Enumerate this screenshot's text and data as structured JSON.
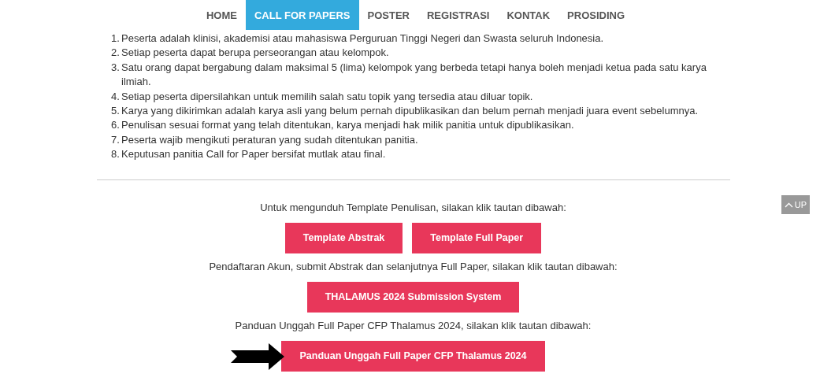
{
  "nav": [
    {
      "label": "HOME",
      "selected": false
    },
    {
      "label": "CALL FOR PAPERS",
      "selected": true
    },
    {
      "label": "POSTER",
      "selected": false
    },
    {
      "label": "REGISTRASI",
      "selected": false
    },
    {
      "label": "KONTAK",
      "selected": false
    },
    {
      "label": "PROSIDING",
      "selected": false
    }
  ],
  "rules": [
    {
      "number": "1.",
      "text": "Peserta adalah klinisi, akademisi atau mahasiswa Perguruan Tinggi Negeri dan Swasta seluruh Indonesia."
    },
    {
      "number": "2.",
      "text": "Setiap peserta dapat berupa perseorangan atau kelompok."
    },
    {
      "number": "3.",
      "text": "Satu orang dapat bergabung dalam maksimal 5 (lima) kelompok yang berbeda tetapi hanya boleh menjadi ketua pada satu karya ilmiah."
    },
    {
      "number": "4.",
      "text": "Setiap peserta dipersilahkan untuk memilih salah satu topik yang tersedia atau diluar topik."
    },
    {
      "number": "5.",
      "text": "Karya yang dikirimkan adalah karya asli yang belum pernah dipublikasikan dan belum pernah menjadi juara event sebelumnya."
    },
    {
      "number": "6.",
      "text": "Penulisan sesuai format yang telah ditentukan, karya menjadi hak milik panitia untuk dipublikasikan."
    },
    {
      "number": "7.",
      "text": "Peserta wajib mengikuti peraturan yang sudah ditentukan panitia."
    },
    {
      "number": "8.",
      "text": "Keputusan panitia Call for Paper bersifat mutlak atau final."
    }
  ],
  "sections": [
    {
      "instruction": "Untuk mengunduh Template Penulisan, silakan klik tautan dibawah:",
      "buttons": [
        "Template Abstrak",
        "Template Full Paper"
      ],
      "pointer_arrow": false
    },
    {
      "instruction": "Pendaftaran Akun, submit Abstrak dan selanjutnya Full Paper, silakan klik tautan dibawah:",
      "buttons": [
        "THALAMUS 2024 Submission System"
      ],
      "pointer_arrow": false
    },
    {
      "instruction": "Panduan Unggah Full Paper CFP Thalamus 2024, silakan klik tautan dibawah:",
      "buttons": [
        "Panduan Unggah Full Paper CFP Thalamus 2024"
      ],
      "pointer_arrow": true
    }
  ],
  "up_button": {
    "label": "UP"
  }
}
